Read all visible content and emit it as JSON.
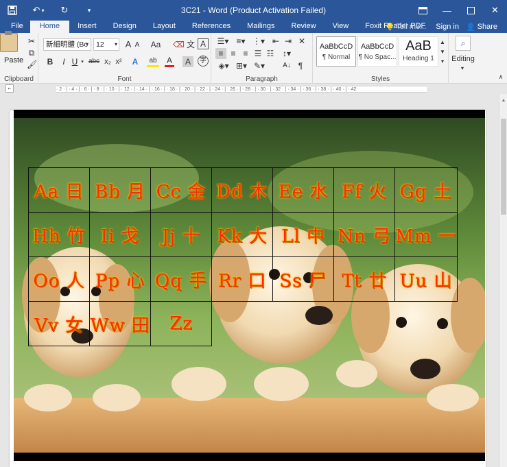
{
  "titlebar": {
    "title": "3C21 - Word (Product Activation Failed)",
    "save_icon": "save-icon",
    "undo_icon": "undo-icon",
    "redo_icon": "redo-icon",
    "qat_icon": "customize-qat-icon",
    "ribbon_display_icon": "ribbon-display-icon",
    "window_controls": [
      "minimize-icon",
      "maximize-icon",
      "close-icon"
    ]
  },
  "tabs": [
    {
      "label": "File"
    },
    {
      "label": "Home"
    },
    {
      "label": "Insert"
    },
    {
      "label": "Design"
    },
    {
      "label": "Layout"
    },
    {
      "label": "References"
    },
    {
      "label": "Mailings"
    },
    {
      "label": "Review"
    },
    {
      "label": "View"
    },
    {
      "label": "Foxit Reader PDF"
    }
  ],
  "tabs_right": {
    "tell_me": "Tell me...",
    "sign_in": "Sign in",
    "share": "Share"
  },
  "ribbon": {
    "clipboard": {
      "paste_label": "Paste",
      "group_label": "Clipboard"
    },
    "font": {
      "font_name": "新細明體 (Bo",
      "font_size": "12",
      "group_label": "Font",
      "grow_label": "A",
      "shrink_label": "A",
      "case_label": "Aa",
      "bold": "B",
      "italic": "I",
      "underline": "U",
      "strike": "abc",
      "subscript": "x₂",
      "superscript": "x²",
      "effects": "A",
      "highlight": "ab",
      "color": "A",
      "charshade": "A"
    },
    "paragraph": {
      "group_label": "Paragraph"
    },
    "styles": {
      "group_label": "Styles",
      "items": [
        {
          "preview": "AaBbCcD",
          "name": "¶ Normal"
        },
        {
          "preview": "AaBbCcD",
          "name": "¶ No Spac..."
        },
        {
          "preview": "AaB",
          "name": "Heading 1"
        }
      ]
    },
    "editing": {
      "label": "Editing"
    }
  },
  "ruler": {
    "ticks": "· 2 · | · 4 · | · 6 · | · 8 · | · 10 · | · 12 · | · 14 · | · 16 · | · 18 · | · 20 · | · 22 · | · 24 · | · 26 · | · 28 · | · 30 · | · 32 · | · 34 · | · 36 · | · 38 · | · 40 · | · 42"
  },
  "alphabet_table": [
    [
      "Aa 日",
      "Bb 月",
      "Cc 金",
      "Dd 木",
      "Ee 水",
      "Ff 火",
      "Gg 土"
    ],
    [
      "Hh 竹",
      "Ii 戈",
      "Jj 十",
      "Kk 大",
      "Ll 中",
      "Nn 弓",
      "Mm 一"
    ],
    [
      "Oo 人",
      "Pp 心",
      "Qq 手",
      "Rr 口",
      "Ss 尸",
      "Tt 廿",
      "Uu 山"
    ],
    [
      "Vv 女",
      "Ww 田",
      "Zz",
      "",
      "",
      "",
      ""
    ]
  ],
  "colors": {
    "word_blue": "#2b579a",
    "cell_text": "#ff2a00",
    "cell_glow": "#ffd200"
  }
}
